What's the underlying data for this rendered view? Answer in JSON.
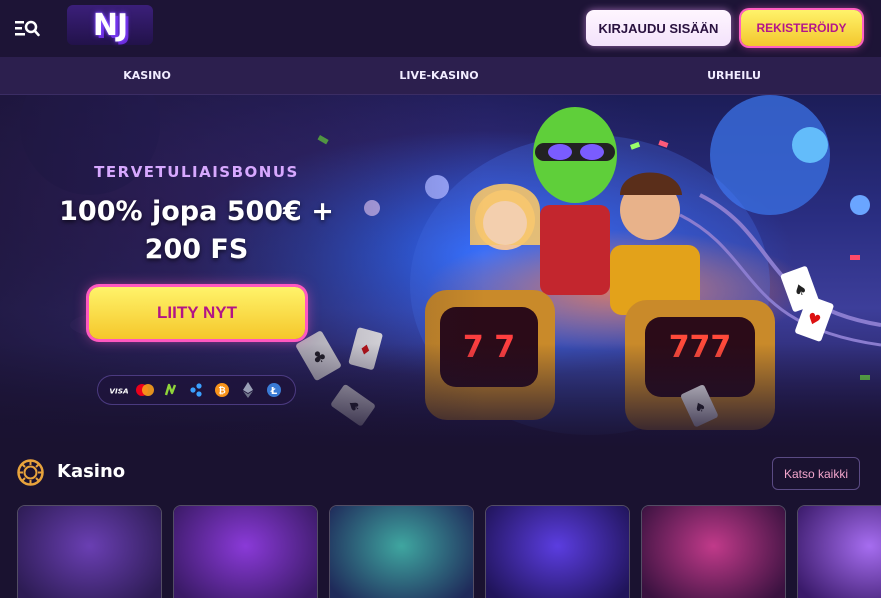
{
  "header": {
    "logo_text": "NJ",
    "login_label": "KIRJAUDU SISÄÄN",
    "register_label": "REKISTERÖIDY"
  },
  "nav": {
    "items": [
      {
        "label": "KASINO"
      },
      {
        "label": "LIVE-KASINO"
      },
      {
        "label": "URHEILU"
      }
    ]
  },
  "hero": {
    "label": "TERVETULIAISBONUS",
    "title": "100% jopa 500€ + 200 FS",
    "cta_label": "LIITY NYT",
    "payment_icons": [
      "visa-icon",
      "mastercard-icon",
      "neteller-icon",
      "skrill-icon",
      "bitcoin-icon",
      "ethereum-icon",
      "litecoin-icon"
    ],
    "payment_visa_text": "VISA"
  },
  "section": {
    "title": "Kasino",
    "see_all_label": "Katso kaikki"
  },
  "games": [
    {
      "name": "game-card-1",
      "color_a": "#6a3fb3",
      "color_b": "#2d1c54"
    },
    {
      "name": "game-card-2",
      "color_a": "#8a3ad8",
      "color_b": "#3a1a66"
    },
    {
      "name": "game-card-3",
      "color_a": "#3fa6a0",
      "color_b": "#1f2a5a"
    },
    {
      "name": "game-card-4",
      "color_a": "#5b3de0",
      "color_b": "#20145a"
    },
    {
      "name": "game-card-5",
      "color_a": "#c13a8a",
      "color_b": "#3a1240"
    },
    {
      "name": "game-card-6",
      "color_a": "#a66df0",
      "color_b": "#3a1a6a"
    }
  ],
  "colors": {
    "background": "#1a1230",
    "nav": "#2c1f4e",
    "accent_yellow": "#f5c72b",
    "accent_pink": "#ff58c0"
  }
}
